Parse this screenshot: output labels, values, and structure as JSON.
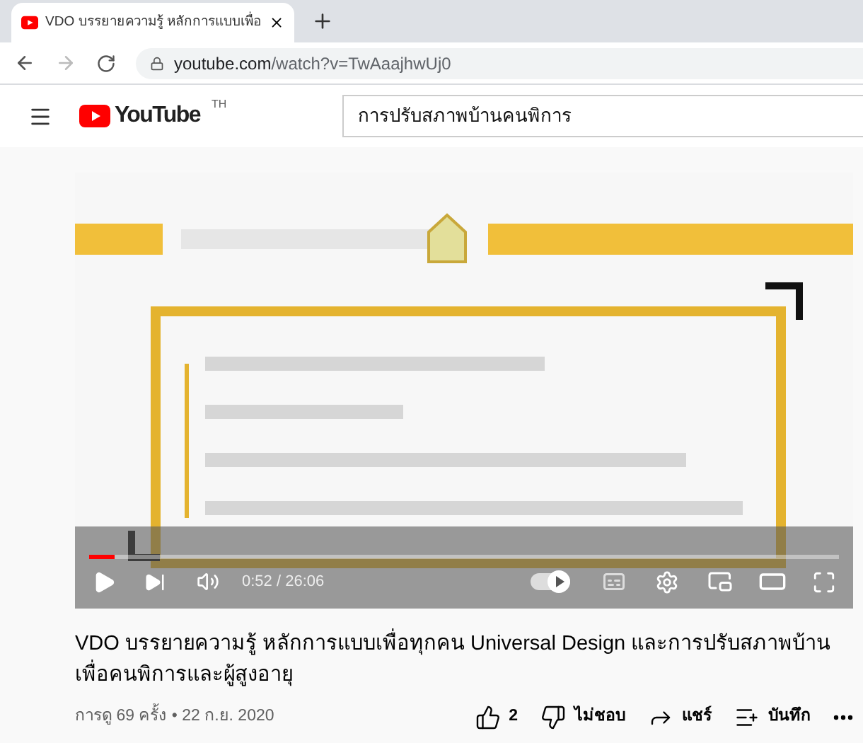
{
  "browser": {
    "tab": {
      "title": "VDO บรรยายความรู้ หลักการแบบเพื่อ"
    },
    "address": {
      "host": "youtube.com",
      "path": "/watch?v=TwAaajhwUj0"
    }
  },
  "header": {
    "logo": "YouTube",
    "country": "TH",
    "search": {
      "value": "การปรับสภาพบ้านคนพิการ"
    }
  },
  "player": {
    "progress": {
      "level": 0.034
    },
    "time": "0:52 / 26:06",
    "autoplay": {
      "on": true
    }
  },
  "video": {
    "title": "VDO บรรยายความรู้ หลักการแบบเพื่อทุกคน Universal Design และการปรับสภาพบ้านเพื่อคนพิการและผู้สูงอายุ",
    "meta": "การดู 69 ครั้ง • 22 ก.ย. 2020"
  },
  "actions": [
    {
      "kind": "like",
      "label": "2"
    },
    {
      "kind": "dislike",
      "label": "ไม่ชอบ"
    },
    {
      "kind": "share",
      "label": "แชร์"
    },
    {
      "kind": "save",
      "label": "บันทึก"
    },
    {
      "kind": "more"
    }
  ]
}
